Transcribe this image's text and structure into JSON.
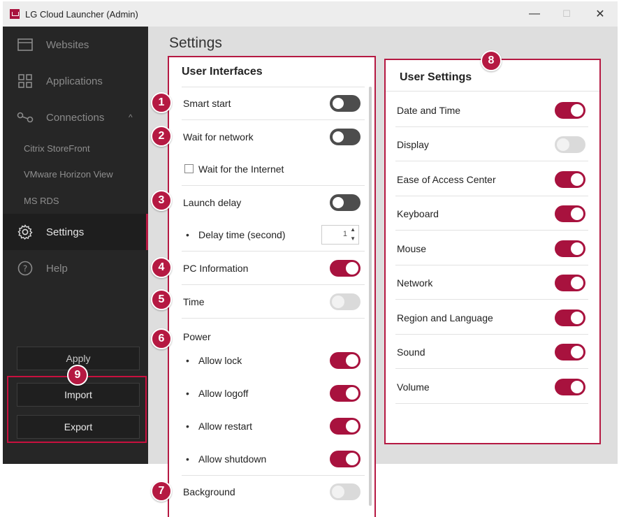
{
  "window": {
    "title": "LG Cloud Launcher (Admin)",
    "minimize": "—",
    "maximize": "☐",
    "close": "✕"
  },
  "sidebar": {
    "websites": "Websites",
    "applications": "Applications",
    "connections": "Connections",
    "connections_chevron": "^",
    "sub_items": [
      "Citrix StoreFront",
      "VMware Horizon View",
      "MS RDS"
    ],
    "settings": "Settings",
    "help": "Help",
    "apply": "Apply",
    "import": "Import",
    "export": "Export"
  },
  "page": {
    "title": "Settings"
  },
  "user_interfaces": {
    "title": "User Interfaces",
    "smart_start": {
      "label": "Smart start",
      "state": "off"
    },
    "wait_network": {
      "label": "Wait for network",
      "state": "off"
    },
    "wait_internet": {
      "label": "Wait for the Internet",
      "checked": false
    },
    "launch_delay": {
      "label": "Launch delay",
      "state": "off"
    },
    "delay_time": {
      "label": "Delay time (second)",
      "value": "1"
    },
    "pc_info": {
      "label": "PC Information",
      "state": "on"
    },
    "time": {
      "label": "Time",
      "state": "disabled"
    },
    "power": {
      "label": "Power"
    },
    "allow_lock": {
      "label": "Allow lock",
      "state": "on"
    },
    "allow_logoff": {
      "label": "Allow logoff",
      "state": "on"
    },
    "allow_restart": {
      "label": "Allow restart",
      "state": "on"
    },
    "allow_shutdown": {
      "label": "Allow shutdown",
      "state": "on"
    },
    "background": {
      "label": "Background",
      "state": "disabled"
    }
  },
  "user_settings": {
    "title": "User Settings",
    "items": [
      {
        "label": "Date and Time",
        "state": "on"
      },
      {
        "label": "Display",
        "state": "disabled"
      },
      {
        "label": "Ease of Access Center",
        "state": "on"
      },
      {
        "label": "Keyboard",
        "state": "on"
      },
      {
        "label": "Mouse",
        "state": "on"
      },
      {
        "label": "Network",
        "state": "on"
      },
      {
        "label": "Region and Language",
        "state": "on"
      },
      {
        "label": "Sound",
        "state": "on"
      },
      {
        "label": "Volume",
        "state": "on"
      }
    ]
  },
  "badges": [
    "1",
    "2",
    "3",
    "4",
    "5",
    "6",
    "7",
    "8",
    "9"
  ],
  "colors": {
    "accent": "#b51942",
    "toggle_on": "#a8123e",
    "sidebar_bg": "#262626"
  }
}
